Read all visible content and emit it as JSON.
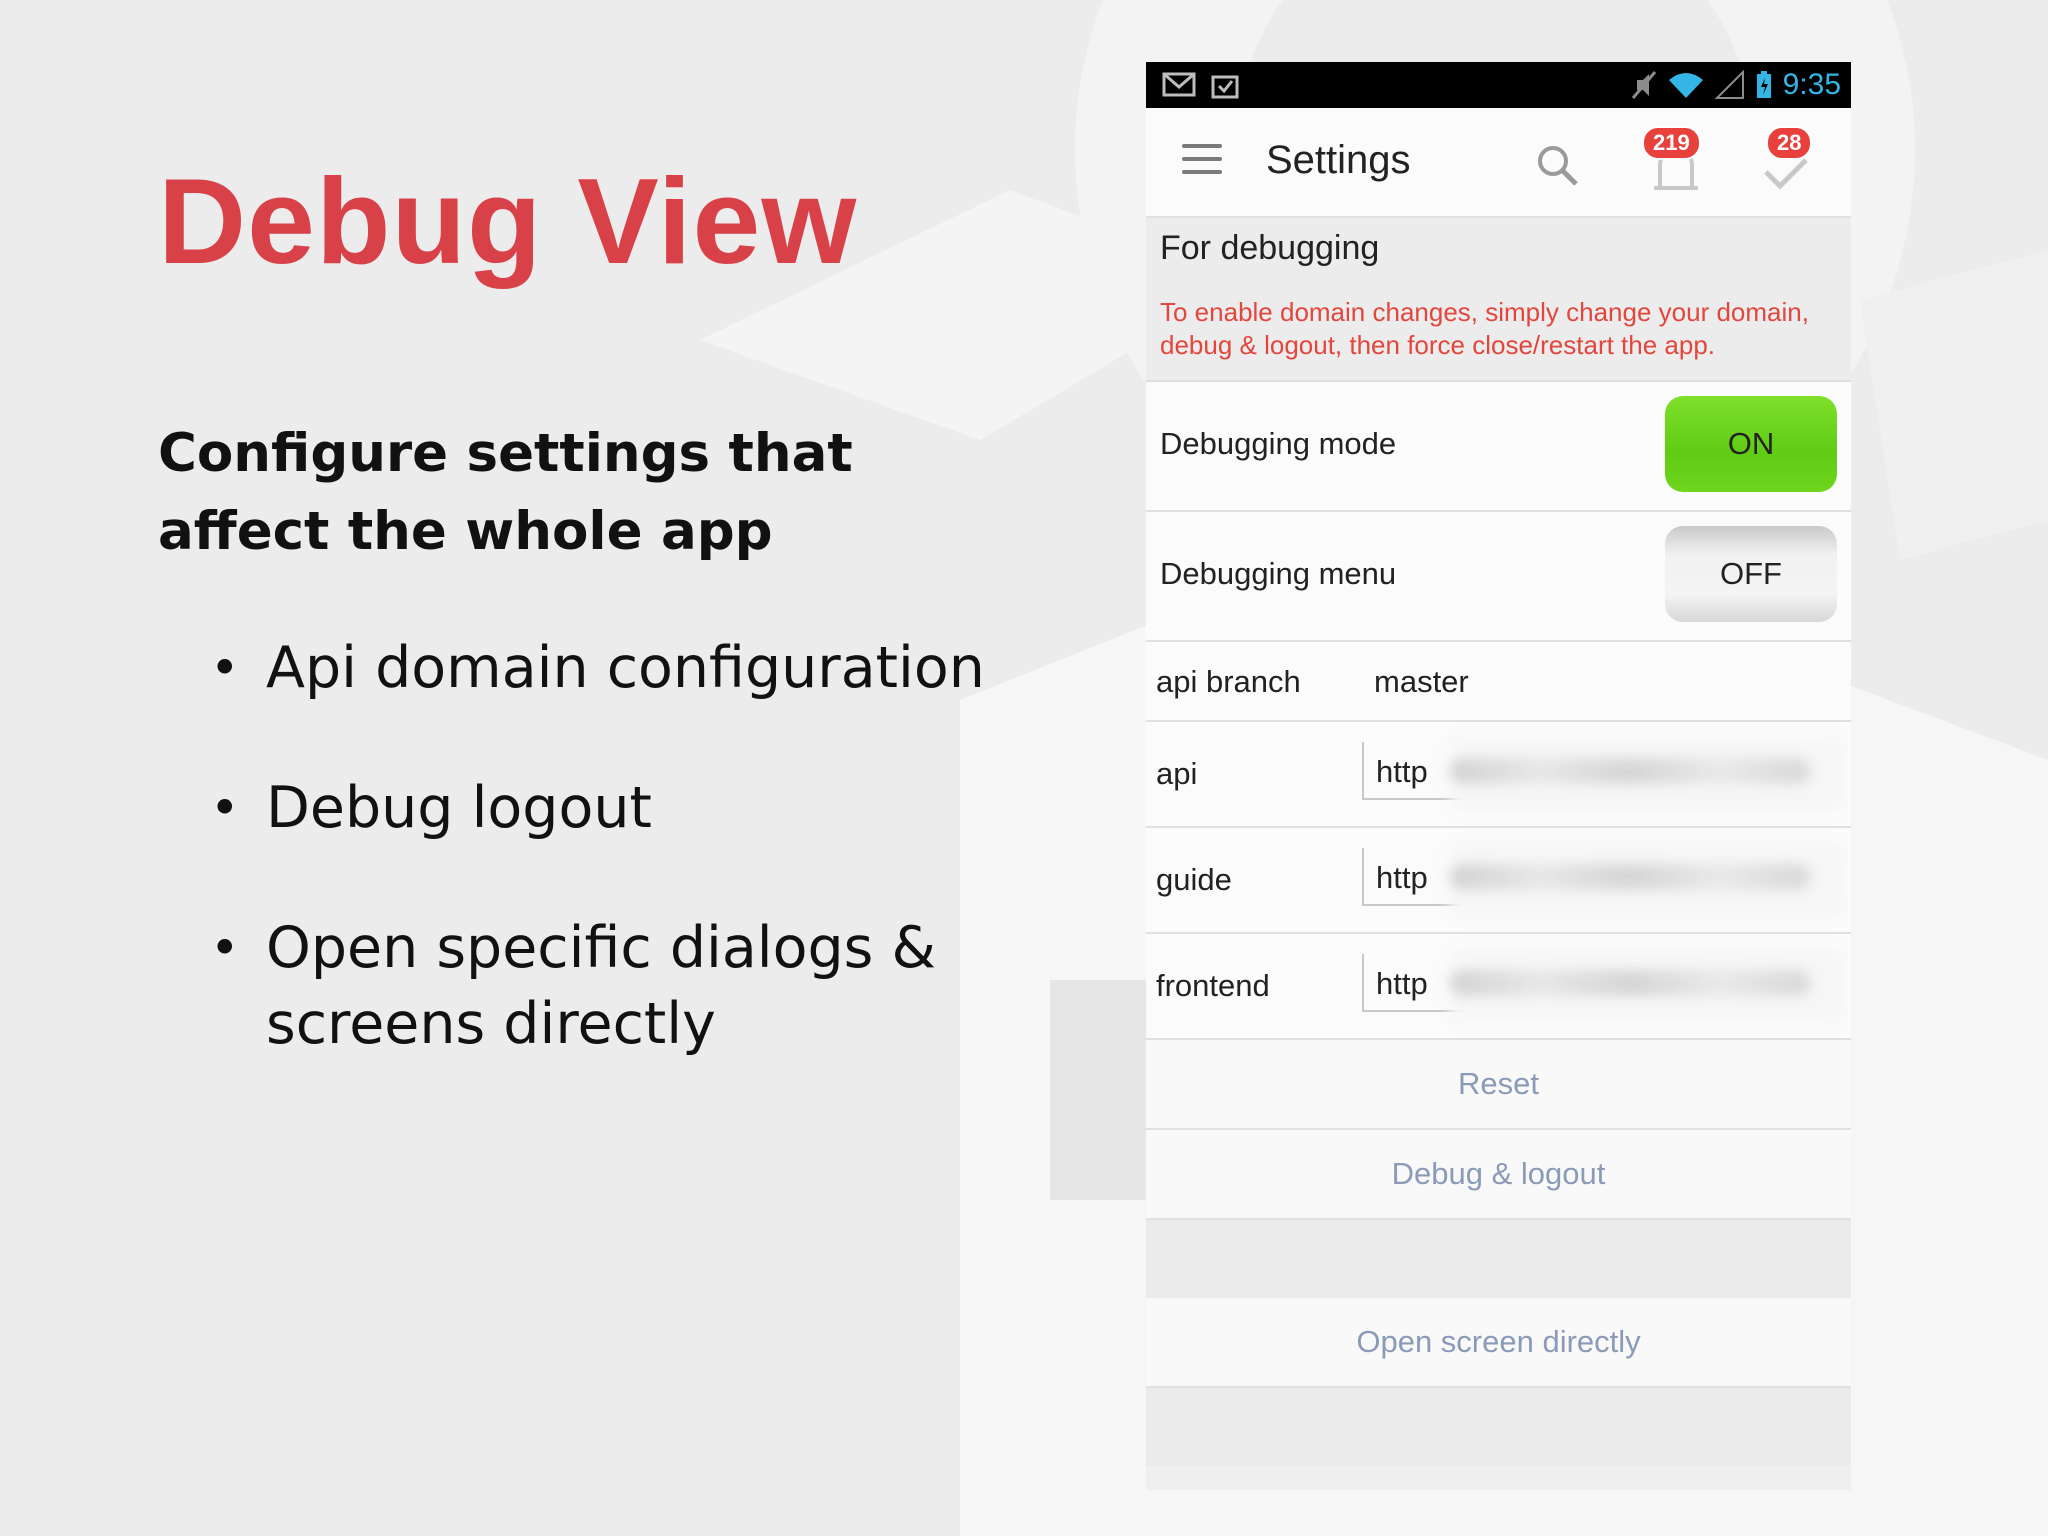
{
  "slide": {
    "title": "Debug View",
    "subtitle": "Configure settings that affect the whole app",
    "bullets": [
      "Api domain configuration",
      "Debug logout",
      "Open specific dialogs & screens directly"
    ],
    "accent_color": "#d94149"
  },
  "phone": {
    "status_bar": {
      "time": "9:35",
      "icons": [
        "gmail-icon",
        "clipboard-check-icon",
        "mute-icon",
        "wifi-icon",
        "signal-icon",
        "battery-icon"
      ]
    },
    "app_bar": {
      "title": "Settings",
      "notifications_badge": "219",
      "tasks_badge": "28"
    },
    "section": {
      "title": "For debugging",
      "note": "To enable domain changes, simply change your domain, debug & logout, then force close/restart the app."
    },
    "toggles": [
      {
        "label": "Debugging mode",
        "state": "ON"
      },
      {
        "label": "Debugging menu",
        "state": "OFF"
      }
    ],
    "fields": {
      "api_branch": {
        "label": "api branch",
        "value": "master"
      },
      "api": {
        "label": "api",
        "value": "http"
      },
      "guide": {
        "label": "guide",
        "value": "http"
      },
      "frontend": {
        "label": "frontend",
        "value": "http"
      }
    },
    "actions": {
      "reset": "Reset",
      "debug_logout": "Debug & logout",
      "open_screen": "Open screen directly"
    },
    "colors": {
      "status_blue": "#33b5e5",
      "badge_red": "#e8413b",
      "toggle_on_green": "#5fcc13",
      "note_red": "#e2463d",
      "action_text": "#8a9bb8"
    }
  }
}
